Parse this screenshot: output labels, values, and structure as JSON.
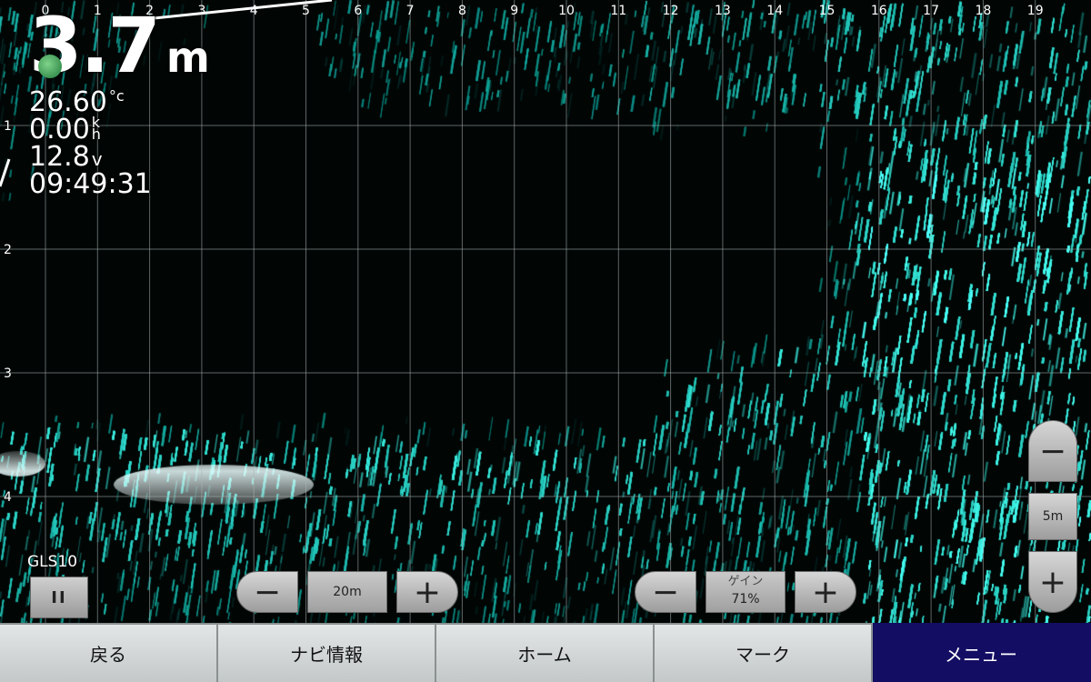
{
  "sonar": {
    "depth_value": "3.7",
    "depth_unit": "m",
    "water_temp_value": "26.60",
    "water_temp_unit": "°c",
    "speed_value": "0.00",
    "speed_unit_top": "k",
    "speed_unit_bottom": "h",
    "voltage_value": "12.8",
    "voltage_unit": "v",
    "clock": "09:49:31",
    "x_ticks": [
      "0",
      "1",
      "2",
      "3",
      "4",
      "5",
      "6",
      "7",
      "8",
      "9",
      "10",
      "11",
      "12",
      "13",
      "14",
      "15",
      "16",
      "17",
      "18",
      "19"
    ],
    "y_ticks": [
      "1",
      "2",
      "3",
      "4"
    ],
    "colors": {
      "echo": "#3fe0d0",
      "background": "#010605",
      "grid": "#aab5b5"
    }
  },
  "transducer": {
    "label": "GLS10",
    "pause_icon": "pause-icon",
    "pause_label": "II"
  },
  "range_control": {
    "minus_label": "−",
    "value": "20m",
    "plus_label": "+"
  },
  "gain_control": {
    "minus_label": "−",
    "label": "ゲイン",
    "value": "71%",
    "plus_label": "+"
  },
  "zoom_control": {
    "minus_label": "−",
    "value": "5m",
    "plus_label": "+"
  },
  "bottom_nav": {
    "items": [
      {
        "label": "戻る"
      },
      {
        "label": "ナビ情報"
      },
      {
        "label": "ホーム"
      },
      {
        "label": "マーク"
      },
      {
        "label": "メニュー",
        "active": true
      }
    ],
    "active_color": "#130d63"
  }
}
